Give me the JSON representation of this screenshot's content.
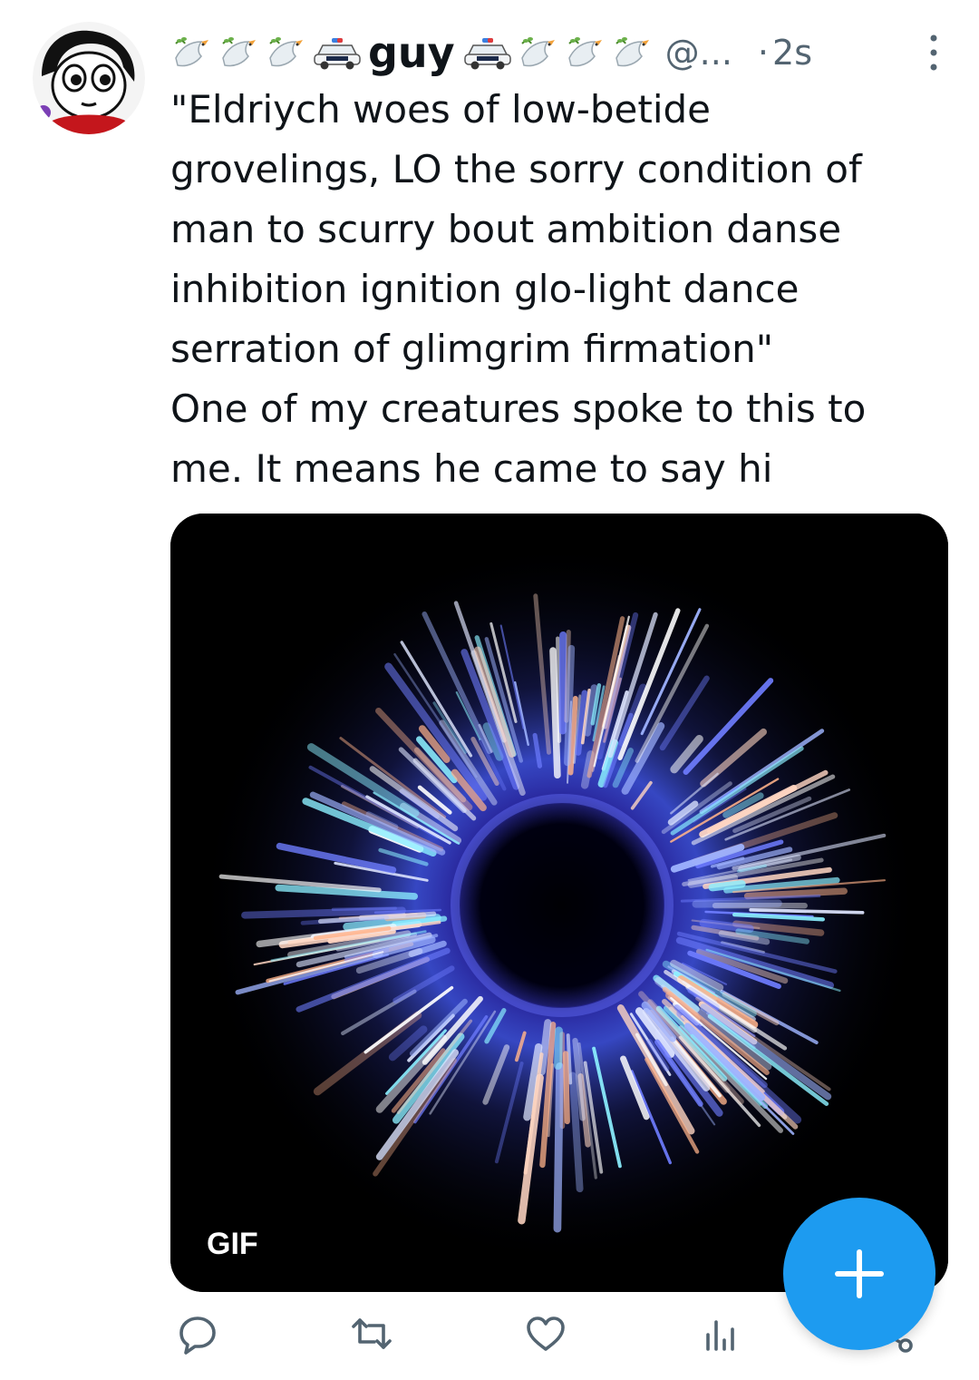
{
  "tweet": {
    "display_name": "guy",
    "name_prefix_emoji": [
      "dove-with-olive-branch",
      "dove-with-olive-branch",
      "dove-with-olive-branch",
      "police-car"
    ],
    "name_suffix_emoji": [
      "police-car",
      "dove-with-olive-branch",
      "dove-with-olive-branch",
      "dove-with-olive-branch"
    ],
    "handle": "@...",
    "separator": "·",
    "time": "2s",
    "text_lines": [
      "\"Eldriych woes of low-betide",
      "grovelings, LO the sorry condition of",
      "man to scurry bout ambition danse",
      "inhibition ignition glo-light dance",
      "serration of glimgrim firmation\"",
      "One of my creatures spoke to this to",
      "me. It means he came to say hi"
    ],
    "media": {
      "badge": "GIF",
      "police_car_label": "POLICE"
    }
  },
  "actions": {
    "icons": [
      "reply-icon",
      "retweet-icon",
      "like-icon",
      "views-icon",
      "share-icon"
    ]
  },
  "fab": {
    "icon": "plus-icon",
    "color": "#1d9bf0"
  },
  "colors": {
    "text": "#0f1419",
    "secondary": "#536471",
    "accent": "#1d9bf0"
  }
}
